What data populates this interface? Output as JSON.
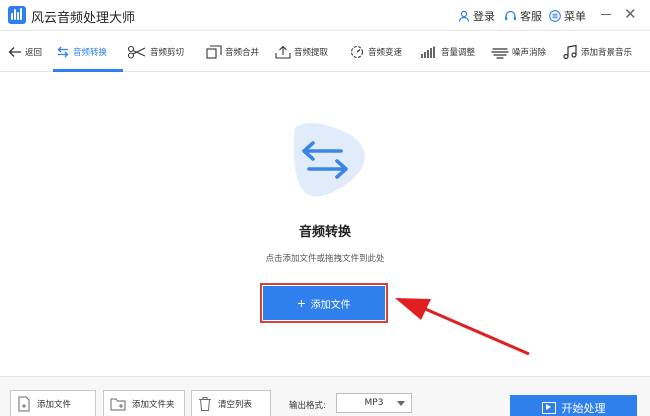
{
  "app": {
    "title": "风云音频处理大师"
  },
  "titlebar": {
    "login": "登录",
    "service": "客服",
    "menu": "菜单"
  },
  "tabs": [
    {
      "label": "返回",
      "icon": "back-arrow-icon"
    },
    {
      "label": "音频转换",
      "icon": "convert-arrows-icon",
      "active": true
    },
    {
      "label": "音频剪切",
      "icon": "scissors-icon"
    },
    {
      "label": "音频合并",
      "icon": "merge-icon"
    },
    {
      "label": "音频提取",
      "icon": "extract-icon"
    },
    {
      "label": "音频变速",
      "icon": "speed-icon"
    },
    {
      "label": "音量调整",
      "icon": "volume-bars-icon"
    },
    {
      "label": "噪声消除",
      "icon": "noise-icon"
    },
    {
      "label": "添加背景音乐",
      "icon": "music-note-icon"
    }
  ],
  "main": {
    "title": "音频转换",
    "hint": "点击添加文件或拖拽文件到此处",
    "add_button": "添加文件"
  },
  "bottom": {
    "add_file": "添加文件",
    "add_folder": "添加文件夹",
    "clear_list": "清空列表",
    "format_label": "输出格式:",
    "format_value": "MP3",
    "start": "开始处理"
  },
  "colors": {
    "accent": "#2f80ed",
    "highlight": "#d94040"
  }
}
